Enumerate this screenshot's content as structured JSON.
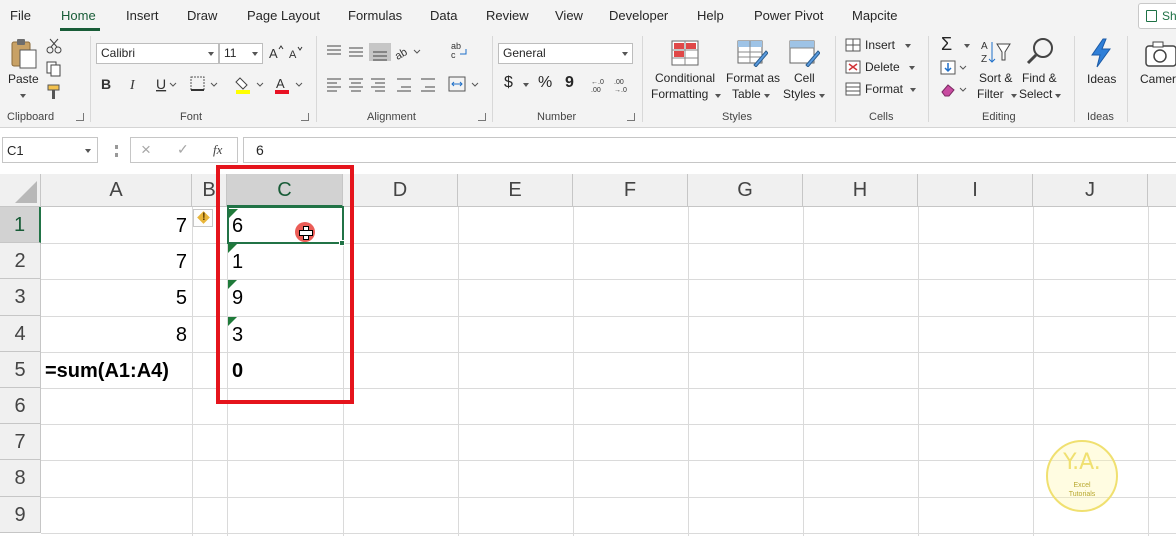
{
  "ribbon": {
    "tabs": [
      "File",
      "Home",
      "Insert",
      "Draw",
      "Page Layout",
      "Formulas",
      "Data",
      "Review",
      "View",
      "Developer",
      "Help",
      "Power Pivot",
      "Mapcite"
    ],
    "active_tab": "Home",
    "share_label": "Sh",
    "clipboard": {
      "paste": "Paste",
      "group": "Clipboard"
    },
    "font": {
      "name": "Calibri",
      "size": "11",
      "group": "Font"
    },
    "alignment": {
      "group": "Alignment"
    },
    "number": {
      "format": "General",
      "currency": "$",
      "percent": "%",
      "comma": "9",
      "group": "Number"
    },
    "styles": {
      "conditional_1": "Conditional",
      "conditional_2": "Formatting",
      "format_as_1": "Format as",
      "format_as_2": "Table",
      "cell_styles_1": "Cell",
      "cell_styles_2": "Styles",
      "group": "Styles"
    },
    "cells": {
      "insert": "Insert",
      "delete": "Delete",
      "format": "Format",
      "group": "Cells"
    },
    "editing": {
      "sum": "Σ",
      "sort_1": "Sort &",
      "sort_2": "Filter",
      "find_1": "Find &",
      "find_2": "Select",
      "group": "Editing"
    },
    "ideas": {
      "label": "Ideas",
      "group": "Ideas"
    },
    "camera": {
      "label": "Camer"
    }
  },
  "formula_bar": {
    "name_box": "C1",
    "cancel": "×",
    "enter": "✓",
    "fx": "fx",
    "value": "6"
  },
  "grid": {
    "columns": [
      "A",
      "B",
      "C",
      "D",
      "E",
      "F",
      "G",
      "H",
      "I",
      "J"
    ],
    "selected_column": "C",
    "rows": [
      "1",
      "2",
      "3",
      "4",
      "5",
      "6",
      "7",
      "8",
      "9"
    ],
    "selected_row": "1",
    "col_a": [
      "7",
      "7",
      "5",
      "8",
      "=sum(A1:A4)"
    ],
    "col_c": [
      "6",
      "1",
      "9",
      "3",
      "0"
    ]
  },
  "watermark": {
    "initials": "Y.A.",
    "line1": "Excel",
    "line2": "Tutorials"
  },
  "colors": {
    "excel_green": "#217346",
    "highlight_red": "#e5141c",
    "error_triangle": "#1f7a3a"
  }
}
